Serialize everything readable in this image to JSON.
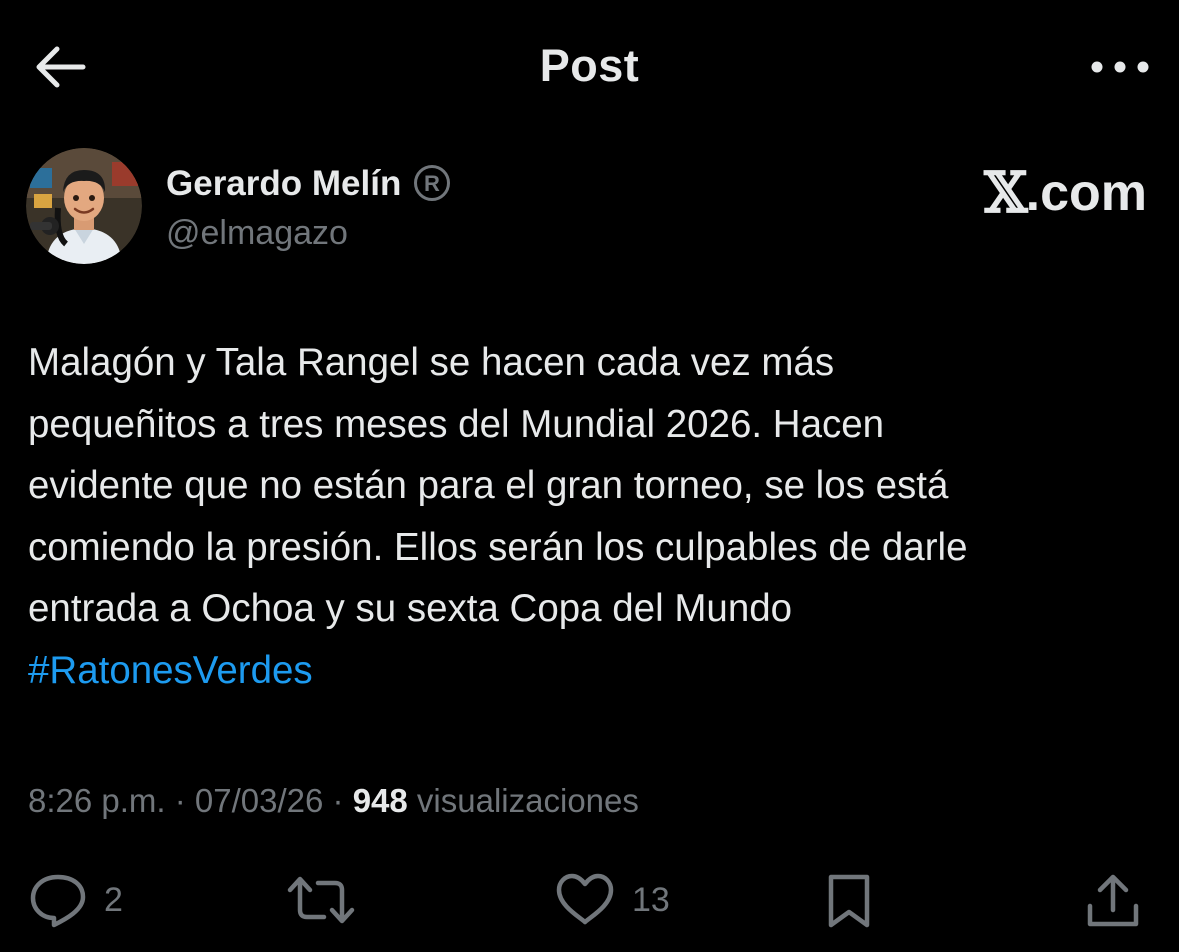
{
  "header": {
    "title": "Post",
    "back_icon": "arrow-left-icon",
    "more_icon": "more-horizontal-icon"
  },
  "author": {
    "name": "Gerardo Melín",
    "handle": "@elmagazo",
    "avatar_icon": "avatar-cartoon",
    "badge_icon": "registered-icon"
  },
  "brand": {
    "x": "𝕏",
    "domain": ".com"
  },
  "post": {
    "lines": [
      "Malagón y Tala Rangel se hacen cada vez más",
      "pequeñitos a tres meses del Mundial 2026. Hacen",
      "evidente que no están para el gran torneo, se los está",
      "comiendo la presión. Ellos serán los culpables de darle",
      "entrada a Ochoa y su sexta Copa del Mundo"
    ],
    "hashtag": "#RatonesVerdes"
  },
  "meta": {
    "time": "8:26 p.m.",
    "sep1": " · ",
    "date": "07/03/26",
    "sep2": " · ",
    "views_count": "948",
    "views_label": " visualizaciones"
  },
  "actions": {
    "reply_count": "2",
    "repost_count": "",
    "like_count": "13"
  },
  "colors": {
    "background": "#000000",
    "text": "#e7e9ea",
    "secondary": "#71767b",
    "link": "#1d9bf0"
  }
}
